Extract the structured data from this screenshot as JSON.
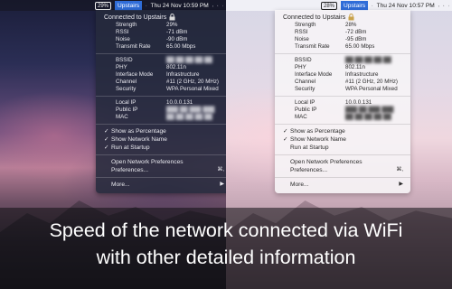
{
  "screens": [
    {
      "theme": "dark",
      "menubar": {
        "percent": "29%",
        "network": "Upstairs",
        "datetime": "Thu 24 Nov  10:59 PM"
      },
      "panel": {
        "title": "Connected to Upstairs",
        "stats": [
          {
            "k": "Strength",
            "v": "29%"
          },
          {
            "k": "RSSI",
            "v": "-71 dBm"
          },
          {
            "k": "Noise",
            "v": "-90 dBm"
          },
          {
            "k": "Transmit Rate",
            "v": "65.00 Mbps"
          }
        ],
        "details": [
          {
            "k": "BSSID",
            "v": "",
            "blur": true
          },
          {
            "k": "PHY",
            "v": "802.11n"
          },
          {
            "k": "Interface Mode",
            "v": "Infrastructure"
          },
          {
            "k": "Channel",
            "v": "#11 (2 GHz, 20 MHz)"
          },
          {
            "k": "Security",
            "v": "WPA Personal Mixed"
          }
        ],
        "ips": [
          {
            "k": "Local IP",
            "v": "10.0.0.131"
          },
          {
            "k": "Public IP",
            "v": "",
            "blur": true
          },
          {
            "k": "MAC",
            "v": "",
            "blur": true
          }
        ],
        "options": [
          {
            "check": "✓",
            "label": "Show as Percentage"
          },
          {
            "check": "✓",
            "label": "Show Network Name"
          },
          {
            "check": "✓",
            "label": "Run at Startup"
          }
        ],
        "open_prefs": "Open Network Preferences",
        "preferences": "Preferences...",
        "preferences_shortcut": "⌘,",
        "more": "More...",
        "more_arrow": "▶"
      }
    },
    {
      "theme": "light",
      "menubar": {
        "percent": "28%",
        "network": "Upstairs",
        "datetime": "Thu 24 Nov  10:57 PM"
      },
      "panel": {
        "title": "Connected to Upstairs",
        "stats": [
          {
            "k": "Strength",
            "v": "28%"
          },
          {
            "k": "RSSI",
            "v": "-72 dBm"
          },
          {
            "k": "Noise",
            "v": "-95 dBm"
          },
          {
            "k": "Transmit Rate",
            "v": "65.00 Mbps"
          }
        ],
        "details": [
          {
            "k": "BSSID",
            "v": "",
            "blur": true
          },
          {
            "k": "PHY",
            "v": "802.11n"
          },
          {
            "k": "Interface Mode",
            "v": "Infrastructure"
          },
          {
            "k": "Channel",
            "v": "#11 (2 GHz, 20 MHz)"
          },
          {
            "k": "Security",
            "v": "WPA Personal Mixed"
          }
        ],
        "ips": [
          {
            "k": "Local IP",
            "v": "10.0.0.131"
          },
          {
            "k": "Public IP",
            "v": "",
            "blur": true
          },
          {
            "k": "MAC",
            "v": "",
            "blur": true
          }
        ],
        "options": [
          {
            "check": "✓",
            "label": "Show as Percentage"
          },
          {
            "check": "✓",
            "label": "Show Network Name"
          },
          {
            "check": "",
            "label": "Run at Startup"
          }
        ],
        "open_prefs": "Open Network Preferences",
        "preferences": "Preferences...",
        "preferences_shortcut": "⌘,",
        "more": "More...",
        "more_arrow": "▶"
      }
    }
  ],
  "caption": {
    "line1": "Speed of the network connected via WiFi",
    "line2": "with other detailed information"
  },
  "colors": {
    "selection_blue": "#2f6cd8"
  }
}
